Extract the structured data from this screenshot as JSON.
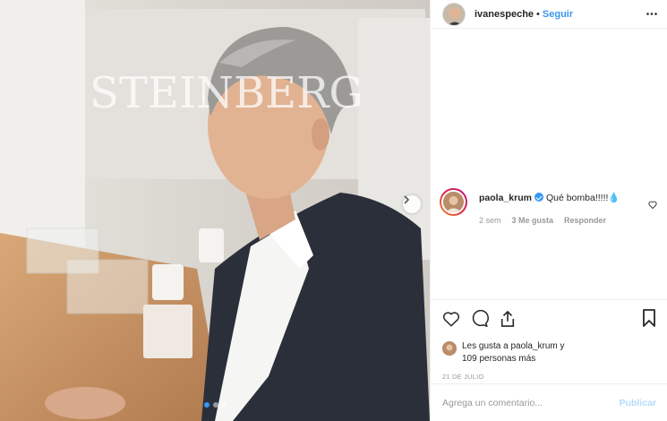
{
  "post": {
    "photo_alt": "Hombre de cabello canoso con camisa blanca y saco oscuro",
    "carousel": {
      "total": 3,
      "current": 1
    },
    "wall_sign": "STEINBERG"
  },
  "header": {
    "username": "ivanespeche",
    "separator": "•",
    "follow_label": "Seguir"
  },
  "comment": {
    "username": "paola_krum",
    "text": "Qué bomba!!!!!💧",
    "time": "2 sem",
    "likes": "3 Me gusta",
    "reply_label": "Responder"
  },
  "likes": {
    "line1": "Les gusta a paola_krum y",
    "line2": "109 personas más"
  },
  "date": "21 DE JULIO",
  "add_comment": {
    "placeholder": "Agrega un comentario...",
    "publish_label": "Publicar"
  },
  "colors": {
    "accent": "#3897f0",
    "publish_disabled": "#b3dbff",
    "muted": "#999999"
  }
}
